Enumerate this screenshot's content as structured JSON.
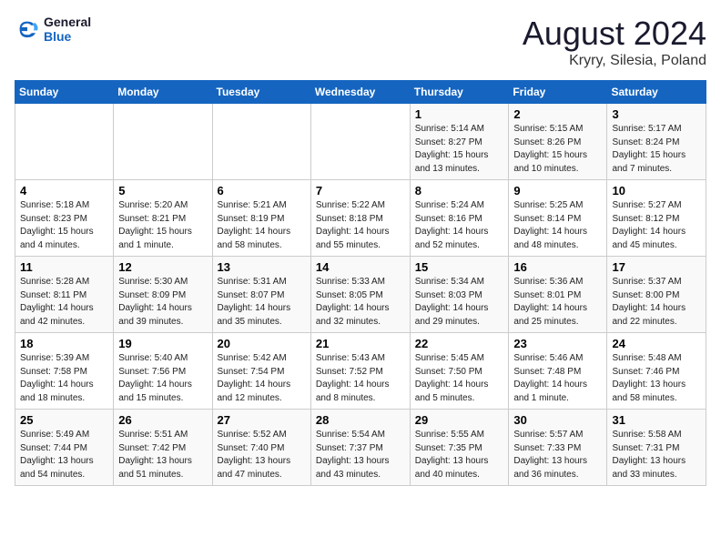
{
  "header": {
    "logo_line1": "General",
    "logo_line2": "Blue",
    "month_year": "August 2024",
    "location": "Kryry, Silesia, Poland"
  },
  "weekdays": [
    "Sunday",
    "Monday",
    "Tuesday",
    "Wednesday",
    "Thursday",
    "Friday",
    "Saturday"
  ],
  "weeks": [
    [
      {
        "day": "",
        "info": ""
      },
      {
        "day": "",
        "info": ""
      },
      {
        "day": "",
        "info": ""
      },
      {
        "day": "",
        "info": ""
      },
      {
        "day": "1",
        "info": "Sunrise: 5:14 AM\nSunset: 8:27 PM\nDaylight: 15 hours\nand 13 minutes."
      },
      {
        "day": "2",
        "info": "Sunrise: 5:15 AM\nSunset: 8:26 PM\nDaylight: 15 hours\nand 10 minutes."
      },
      {
        "day": "3",
        "info": "Sunrise: 5:17 AM\nSunset: 8:24 PM\nDaylight: 15 hours\nand 7 minutes."
      }
    ],
    [
      {
        "day": "4",
        "info": "Sunrise: 5:18 AM\nSunset: 8:23 PM\nDaylight: 15 hours\nand 4 minutes."
      },
      {
        "day": "5",
        "info": "Sunrise: 5:20 AM\nSunset: 8:21 PM\nDaylight: 15 hours\nand 1 minute."
      },
      {
        "day": "6",
        "info": "Sunrise: 5:21 AM\nSunset: 8:19 PM\nDaylight: 14 hours\nand 58 minutes."
      },
      {
        "day": "7",
        "info": "Sunrise: 5:22 AM\nSunset: 8:18 PM\nDaylight: 14 hours\nand 55 minutes."
      },
      {
        "day": "8",
        "info": "Sunrise: 5:24 AM\nSunset: 8:16 PM\nDaylight: 14 hours\nand 52 minutes."
      },
      {
        "day": "9",
        "info": "Sunrise: 5:25 AM\nSunset: 8:14 PM\nDaylight: 14 hours\nand 48 minutes."
      },
      {
        "day": "10",
        "info": "Sunrise: 5:27 AM\nSunset: 8:12 PM\nDaylight: 14 hours\nand 45 minutes."
      }
    ],
    [
      {
        "day": "11",
        "info": "Sunrise: 5:28 AM\nSunset: 8:11 PM\nDaylight: 14 hours\nand 42 minutes."
      },
      {
        "day": "12",
        "info": "Sunrise: 5:30 AM\nSunset: 8:09 PM\nDaylight: 14 hours\nand 39 minutes."
      },
      {
        "day": "13",
        "info": "Sunrise: 5:31 AM\nSunset: 8:07 PM\nDaylight: 14 hours\nand 35 minutes."
      },
      {
        "day": "14",
        "info": "Sunrise: 5:33 AM\nSunset: 8:05 PM\nDaylight: 14 hours\nand 32 minutes."
      },
      {
        "day": "15",
        "info": "Sunrise: 5:34 AM\nSunset: 8:03 PM\nDaylight: 14 hours\nand 29 minutes."
      },
      {
        "day": "16",
        "info": "Sunrise: 5:36 AM\nSunset: 8:01 PM\nDaylight: 14 hours\nand 25 minutes."
      },
      {
        "day": "17",
        "info": "Sunrise: 5:37 AM\nSunset: 8:00 PM\nDaylight: 14 hours\nand 22 minutes."
      }
    ],
    [
      {
        "day": "18",
        "info": "Sunrise: 5:39 AM\nSunset: 7:58 PM\nDaylight: 14 hours\nand 18 minutes."
      },
      {
        "day": "19",
        "info": "Sunrise: 5:40 AM\nSunset: 7:56 PM\nDaylight: 14 hours\nand 15 minutes."
      },
      {
        "day": "20",
        "info": "Sunrise: 5:42 AM\nSunset: 7:54 PM\nDaylight: 14 hours\nand 12 minutes."
      },
      {
        "day": "21",
        "info": "Sunrise: 5:43 AM\nSunset: 7:52 PM\nDaylight: 14 hours\nand 8 minutes."
      },
      {
        "day": "22",
        "info": "Sunrise: 5:45 AM\nSunset: 7:50 PM\nDaylight: 14 hours\nand 5 minutes."
      },
      {
        "day": "23",
        "info": "Sunrise: 5:46 AM\nSunset: 7:48 PM\nDaylight: 14 hours\nand 1 minute."
      },
      {
        "day": "24",
        "info": "Sunrise: 5:48 AM\nSunset: 7:46 PM\nDaylight: 13 hours\nand 58 minutes."
      }
    ],
    [
      {
        "day": "25",
        "info": "Sunrise: 5:49 AM\nSunset: 7:44 PM\nDaylight: 13 hours\nand 54 minutes."
      },
      {
        "day": "26",
        "info": "Sunrise: 5:51 AM\nSunset: 7:42 PM\nDaylight: 13 hours\nand 51 minutes."
      },
      {
        "day": "27",
        "info": "Sunrise: 5:52 AM\nSunset: 7:40 PM\nDaylight: 13 hours\nand 47 minutes."
      },
      {
        "day": "28",
        "info": "Sunrise: 5:54 AM\nSunset: 7:37 PM\nDaylight: 13 hours\nand 43 minutes."
      },
      {
        "day": "29",
        "info": "Sunrise: 5:55 AM\nSunset: 7:35 PM\nDaylight: 13 hours\nand 40 minutes."
      },
      {
        "day": "30",
        "info": "Sunrise: 5:57 AM\nSunset: 7:33 PM\nDaylight: 13 hours\nand 36 minutes."
      },
      {
        "day": "31",
        "info": "Sunrise: 5:58 AM\nSunset: 7:31 PM\nDaylight: 13 hours\nand 33 minutes."
      }
    ]
  ]
}
